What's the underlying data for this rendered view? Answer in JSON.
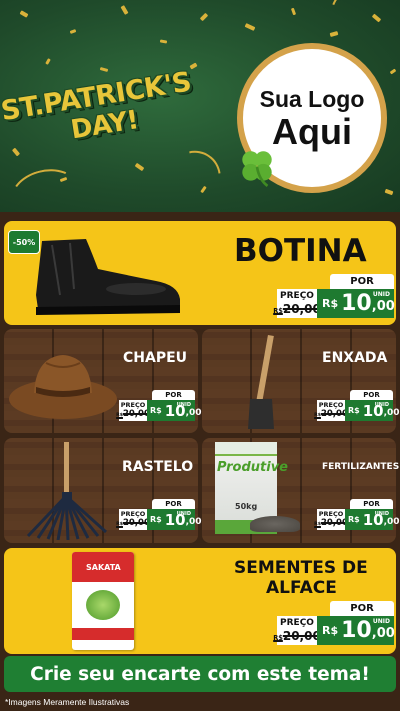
{
  "header": {
    "title_line1": "ST.PATRICK'S",
    "title_line2": "DAY!",
    "logo_line1": "Sua Logo",
    "logo_line2": "Aqui"
  },
  "featured": {
    "discount": "-50%",
    "name": "BOTINA",
    "price": {
      "por": "POR",
      "preco": "PREÇO",
      "old_prefix": "R$",
      "old": "20,00",
      "currency": "R$",
      "int": "10",
      "dec": ",00",
      "unid": "UNID"
    }
  },
  "grid": [
    {
      "name": "CHAPEU",
      "price": {
        "por": "POR",
        "preco": "PREÇO",
        "old_prefix": "R$",
        "old": "20,00",
        "currency": "R$",
        "int": "10",
        "dec": ",00",
        "unid": "UNID"
      }
    },
    {
      "name": "ENXADA",
      "price": {
        "por": "POR",
        "preco": "PREÇO",
        "old_prefix": "R$",
        "old": "20,00",
        "currency": "R$",
        "int": "10",
        "dec": ",00",
        "unid": "UNID"
      }
    },
    {
      "name": "RASTELO",
      "price": {
        "por": "POR",
        "preco": "PREÇO",
        "old_prefix": "R$",
        "old": "20,00",
        "currency": "R$",
        "int": "10",
        "dec": ",00",
        "unid": "UNID"
      }
    },
    {
      "name": "FERTILIZANTES",
      "bag_label": "Produtive",
      "bag_weight": "50kg",
      "price": {
        "por": "POR",
        "preco": "PREÇO",
        "old_prefix": "R$",
        "old": "20,00",
        "currency": "R$",
        "int": "10",
        "dec": ",00",
        "unid": "UNID"
      }
    }
  ],
  "bottom": {
    "name_line1": "SEMENTES DE",
    "name_line2": "ALFACE",
    "packet_brand": "SAKATA",
    "price": {
      "por": "POR",
      "preco": "PREÇO",
      "old_prefix": "R$",
      "old": "20,00",
      "currency": "R$",
      "int": "10",
      "dec": ",00",
      "unid": "UNID"
    }
  },
  "cta": "Crie seu encarte com este tema!",
  "footer_note": "*Imagens Meramente Ilustrativas",
  "colors": {
    "green": "#1e7a30",
    "yellow": "#f5c518",
    "gold": "#e8c63a",
    "wood": "#5a3a22"
  }
}
